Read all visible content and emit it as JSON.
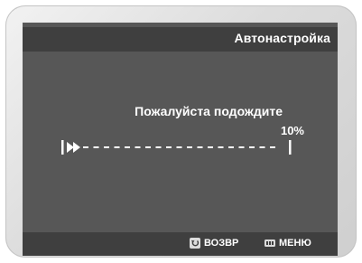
{
  "header": {
    "title": "Автонастройка"
  },
  "main": {
    "message": "Пожалуйста подождите",
    "progress_label": "10%",
    "progress_value": 0.1
  },
  "footer": {
    "back_label": "ВОЗВР",
    "menu_label": "МЕНЮ"
  },
  "icons": {
    "back": "return-icon",
    "menu": "menu-icon",
    "play": "fast-forward-icon"
  },
  "colors": {
    "screen_bg": "#575757",
    "bar_bg": "#3f3f3f",
    "text": "#ffffff"
  }
}
